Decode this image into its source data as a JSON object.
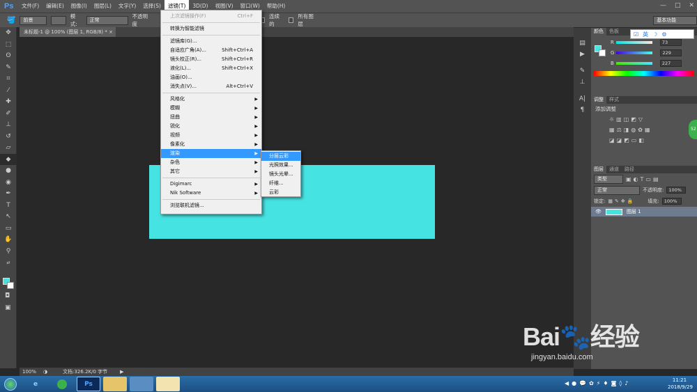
{
  "app": {
    "logo": "Ps"
  },
  "menubar": [
    "文件(F)",
    "编辑(E)",
    "图像(I)",
    "图层(L)",
    "文字(Y)",
    "选择(S)",
    "滤镜(T)",
    "3D(D)",
    "视图(V)",
    "窗口(W)",
    "帮助(H)"
  ],
  "window_controls": [
    "—",
    "□",
    "✕"
  ],
  "options": {
    "tool_icon": "paint-bucket-icon",
    "fill_source": "前景",
    "mode_label": "模式:",
    "mode_value": "正常",
    "opacity_label": "不透明度",
    "contiguous_label": "连续的",
    "all_layers_label": "所有图层",
    "workspace": "基本功能"
  },
  "document": {
    "tab_title": "未标题-1 @ 100% (图层 1, RGB/8) *",
    "close": "×",
    "zoom": "100%",
    "doc_info": "文档:326.2K/0 字节"
  },
  "filter_menu": {
    "items": [
      {
        "label": "上次滤镜操作(F)",
        "shortcut": "Ctrl+F",
        "disabled": true
      },
      {
        "sep": true
      },
      {
        "label": "转换为智能滤镜"
      },
      {
        "sep": true
      },
      {
        "label": "滤镜库(G)..."
      },
      {
        "label": "自适应广角(A)...",
        "shortcut": "Shift+Ctrl+A"
      },
      {
        "label": "镜头校正(R)...",
        "shortcut": "Shift+Ctrl+R"
      },
      {
        "label": "液化(L)...",
        "shortcut": "Shift+Ctrl+X"
      },
      {
        "label": "油画(O)..."
      },
      {
        "label": "消失点(V)...",
        "shortcut": "Alt+Ctrl+V"
      },
      {
        "sep": true
      },
      {
        "label": "风格化",
        "submenu": true
      },
      {
        "label": "模糊",
        "submenu": true
      },
      {
        "label": "扭曲",
        "submenu": true
      },
      {
        "label": "锐化",
        "submenu": true
      },
      {
        "label": "视频",
        "submenu": true
      },
      {
        "label": "像素化",
        "submenu": true
      },
      {
        "label": "渲染",
        "submenu": true,
        "highlighted": true
      },
      {
        "label": "杂色",
        "submenu": true
      },
      {
        "label": "其它",
        "submenu": true
      },
      {
        "sep": true
      },
      {
        "label": "Digimarc",
        "submenu": true
      },
      {
        "label": "Nik Software",
        "submenu": true
      },
      {
        "sep": true
      },
      {
        "label": "浏览联机滤镜..."
      }
    ]
  },
  "render_submenu": [
    {
      "label": "分层云彩",
      "highlighted": true
    },
    {
      "label": "光照效果..."
    },
    {
      "label": "镜头光晕..."
    },
    {
      "label": "纤维..."
    },
    {
      "label": "云彩"
    }
  ],
  "color_panel": {
    "tabs": [
      "颜色",
      "色板"
    ],
    "channels": [
      {
        "name": "R",
        "value": "73"
      },
      {
        "name": "G",
        "value": "229"
      },
      {
        "name": "B",
        "value": "227"
      }
    ],
    "foreground": "#49e5e3"
  },
  "adjust_panel": {
    "tabs": [
      "调整",
      "样式"
    ],
    "title": "添加调整"
  },
  "layers_panel": {
    "tabs": [
      "图层",
      "通道",
      "路径"
    ],
    "kind": "类型",
    "blend": "正常",
    "opacity_label": "不透明度:",
    "opacity": "100%",
    "lock_label": "锁定:",
    "fill_label": "填充:",
    "fill": "100%",
    "layer_name": "图层 1",
    "layer_color": "#46e3e3"
  },
  "ime": {
    "items": [
      "英",
      "☽",
      "⚙"
    ]
  },
  "green_badge": "52",
  "taskbar": {
    "apps": [
      "IE",
      "360",
      "Ps",
      "Explorer",
      "Screen",
      "User"
    ],
    "time": "11:21",
    "date": "2018/9/29"
  },
  "watermark": {
    "logo": "Bai🐾经验",
    "url": "jingyan.baidu.com"
  },
  "canvas_color": "#46e3e3"
}
